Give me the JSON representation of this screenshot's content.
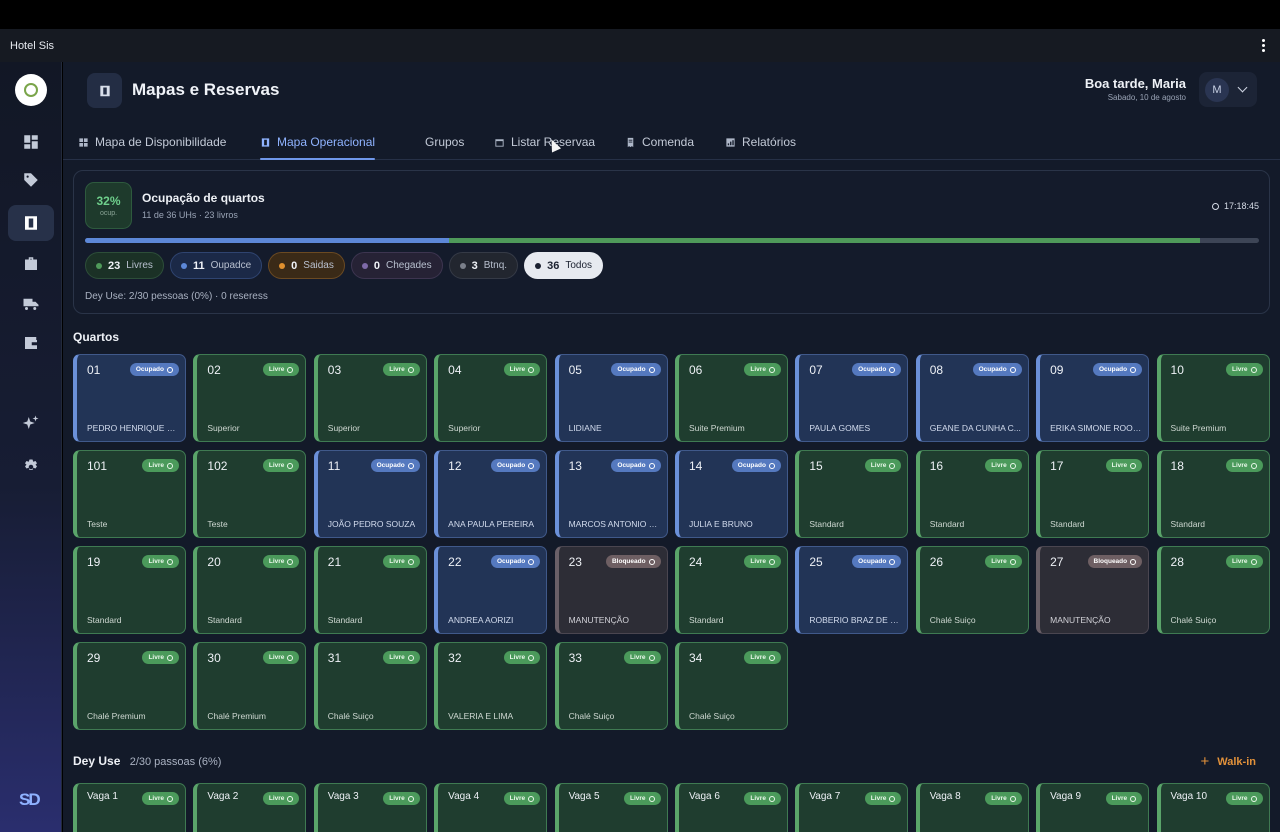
{
  "app": {
    "title": "Hotel Sis"
  },
  "page": {
    "title": "Mapas e Reservas"
  },
  "user": {
    "greeting": "Boa tarde, Maria",
    "date": "Sabado, 10 de agosto",
    "initial": "M"
  },
  "tabs": [
    {
      "label": "Mapa de Disponibilidade",
      "icon": "grid-icon",
      "active": false
    },
    {
      "label": "Mapa Operacional",
      "icon": "map-icon",
      "active": true
    },
    {
      "label": "Grupos",
      "icon": "",
      "active": false
    },
    {
      "label": "Listar Reservaa",
      "icon": "calendar-icon",
      "active": false
    },
    {
      "label": "Comenda",
      "icon": "receipt-icon",
      "active": false
    },
    {
      "label": "Relatórios",
      "icon": "report-icon",
      "active": false
    }
  ],
  "occupancy": {
    "percent": "32%",
    "percent_label": "ocup.",
    "title": "Ocupação de quartos",
    "subtitle": "11 de 36 UHs · 23 livros",
    "time": "17:18:45",
    "bar_occupied_fraction": 0.31,
    "bar_free_fraction": 0.64,
    "day_use_text": "Dey Use: 2/30 pessoas (0%) · 0 reseress"
  },
  "chips": [
    {
      "count": "23",
      "label": "Livres",
      "tone": "green",
      "color": "#4f9a5a"
    },
    {
      "count": "11",
      "label": "Oupadce",
      "tone": "blue",
      "color": "#5d88d8"
    },
    {
      "count": "0",
      "label": "Saidas",
      "tone": "orange",
      "color": "#e0902e"
    },
    {
      "count": "0",
      "label": "Chegades",
      "tone": "purple",
      "color": "#7e6aa8"
    },
    {
      "count": "3",
      "label": "Btnq.",
      "tone": "grey",
      "color": "#7a7f8a"
    },
    {
      "count": "36",
      "label": "Todos",
      "tone": "all",
      "color": "#1b2130"
    }
  ],
  "sections": {
    "rooms_title": "Quartos",
    "dayuse_title": "Dey Use",
    "dayuse_sub": "2/30 passoas (6%)",
    "walkin_label": "Walk-in"
  },
  "rooms": [
    {
      "num": "01",
      "status": "ocupado",
      "badge": "Ocupado",
      "label": "PEDRO HENRIQUE SI..."
    },
    {
      "num": "02",
      "status": "livre",
      "badge": "Livre",
      "label": "Superior"
    },
    {
      "num": "03",
      "status": "livre",
      "badge": "Livre",
      "label": "Superior"
    },
    {
      "num": "04",
      "status": "livre",
      "badge": "Livre",
      "label": "Superior"
    },
    {
      "num": "05",
      "status": "ocupado",
      "badge": "Ocupado",
      "label": "LIDIANE"
    },
    {
      "num": "06",
      "status": "livre",
      "badge": "Livre",
      "label": "Suite Premium"
    },
    {
      "num": "07",
      "status": "ocupado",
      "badge": "Ocupado",
      "label": "PAULA GOMES"
    },
    {
      "num": "08",
      "status": "ocupado",
      "badge": "Ocupado",
      "label": "GEANE DA CUNHA C..."
    },
    {
      "num": "09",
      "status": "ocupado",
      "badge": "Ocupado",
      "label": "ERIKA SIMONE ROOR..."
    },
    {
      "num": "10",
      "status": "livre",
      "badge": "Livre",
      "label": "Suite Premium"
    },
    {
      "num": "101",
      "status": "livre",
      "badge": "Livre",
      "label": "Teste"
    },
    {
      "num": "102",
      "status": "livre",
      "badge": "Livre",
      "label": "Teste"
    },
    {
      "num": "11",
      "status": "ocupado",
      "badge": "Ocupado",
      "label": "JOÃO PEDRO SOUZA"
    },
    {
      "num": "12",
      "status": "ocupado",
      "badge": "Ocupado",
      "label": "ANA PAULA PEREIRA"
    },
    {
      "num": "13",
      "status": "ocupado",
      "badge": "Ocupado",
      "label": "MARCOS ANTONIO C..."
    },
    {
      "num": "14",
      "status": "ocupado",
      "badge": "Ocupado",
      "label": "JULIA E BRUNO"
    },
    {
      "num": "15",
      "status": "livre",
      "badge": "Livre",
      "label": "Standard"
    },
    {
      "num": "16",
      "status": "livre",
      "badge": "Livre",
      "label": "Standard"
    },
    {
      "num": "17",
      "status": "livre",
      "badge": "Livre",
      "label": "Standard"
    },
    {
      "num": "18",
      "status": "livre",
      "badge": "Livre",
      "label": "Standard"
    },
    {
      "num": "19",
      "status": "livre",
      "badge": "Livre",
      "label": "Standard"
    },
    {
      "num": "20",
      "status": "livre",
      "badge": "Livre",
      "label": "Standard"
    },
    {
      "num": "21",
      "status": "livre",
      "badge": "Livre",
      "label": "Standard"
    },
    {
      "num": "22",
      "status": "ocupado",
      "badge": "Ocupado",
      "label": "ANDREA AORIZI"
    },
    {
      "num": "23",
      "status": "bloq",
      "badge": "Bloqueado",
      "label": "MANUTENÇÃO"
    },
    {
      "num": "24",
      "status": "livre",
      "badge": "Livre",
      "label": "Standard"
    },
    {
      "num": "25",
      "status": "ocupado",
      "badge": "Ocupado",
      "label": "ROBERIO BRAZ DE D..."
    },
    {
      "num": "26",
      "status": "livre",
      "badge": "Livre",
      "label": "Chalé Suiço"
    },
    {
      "num": "27",
      "status": "bloq",
      "badge": "Bloqueado",
      "label": "MANUTENÇÃO"
    },
    {
      "num": "28",
      "status": "livre",
      "badge": "Livre",
      "label": "Chalé Suiço"
    },
    {
      "num": "29",
      "status": "livre",
      "badge": "Livre",
      "label": "Chalé Premium"
    },
    {
      "num": "30",
      "status": "livre",
      "badge": "Livre",
      "label": "Chalé Premium"
    },
    {
      "num": "31",
      "status": "livre",
      "badge": "Livre",
      "label": "Chalé Suiço"
    },
    {
      "num": "32",
      "status": "livre",
      "badge": "Livre",
      "label": "VALERIA E LIMA"
    },
    {
      "num": "33",
      "status": "livre",
      "badge": "Livre",
      "label": "Chalé Suiço"
    },
    {
      "num": "34",
      "status": "livre",
      "badge": "Livre",
      "label": "Chalé Suiço"
    }
  ],
  "vagas": [
    {
      "num": "Vaga 1",
      "badge": "Livre"
    },
    {
      "num": "Vaga 2",
      "badge": "Livre"
    },
    {
      "num": "Vaga 3",
      "badge": "Livre"
    },
    {
      "num": "Vaga 4",
      "badge": "Livre"
    },
    {
      "num": "Vaga 5",
      "badge": "Livre"
    },
    {
      "num": "Vaga 6",
      "badge": "Livre"
    },
    {
      "num": "Vaga 7",
      "badge": "Livre"
    },
    {
      "num": "Vaga 8",
      "badge": "Livre"
    },
    {
      "num": "Vaga 9",
      "badge": "Livre"
    },
    {
      "num": "Vaga 10",
      "badge": "Livre"
    }
  ],
  "sidebar": {
    "items": [
      {
        "icon": "dashboard-icon",
        "active": false
      },
      {
        "icon": "tag-icon",
        "active": false
      },
      {
        "icon": "map-icon",
        "active": true
      },
      {
        "icon": "briefcase-icon",
        "active": false
      },
      {
        "icon": "truck-icon",
        "active": false
      },
      {
        "icon": "wallet-icon",
        "active": false
      },
      {
        "icon": "sparkles-icon",
        "active": false
      },
      {
        "icon": "settings-icon",
        "active": false
      }
    ],
    "footer_logo": "SD"
  }
}
